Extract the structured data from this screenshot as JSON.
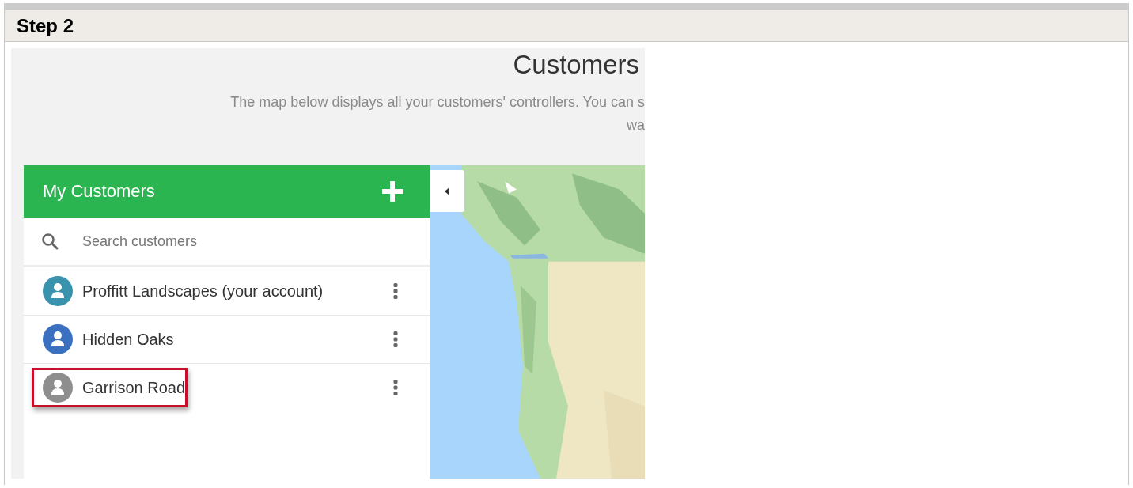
{
  "step": {
    "title": "Step 2"
  },
  "page": {
    "title": "Customers",
    "intro": [
      "The map below displays all your customers' controllers. You can s",
      "wa"
    ]
  },
  "panel": {
    "title": "My Customers",
    "search": {
      "placeholder": "Search customers"
    },
    "customers": [
      {
        "name": "Proffitt Landscapes (your account)",
        "color": "#3a93ad",
        "highlighted": false
      },
      {
        "name": "Hidden Oaks",
        "color": "#3b6fbf",
        "highlighted": false
      },
      {
        "name": "Garrison Road",
        "color": "#8e8e8e",
        "highlighted": true
      }
    ]
  }
}
